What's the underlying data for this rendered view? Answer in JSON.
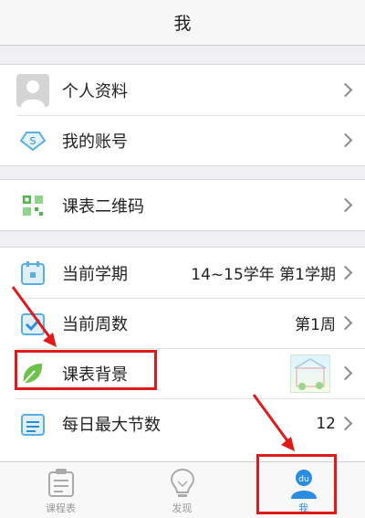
{
  "header": {
    "title": "我"
  },
  "profile_section": {
    "items": [
      {
        "label": "个人资料",
        "icon": "avatar-icon"
      },
      {
        "label": "我的账号",
        "icon": "account-diamond-icon"
      }
    ]
  },
  "qr_section": {
    "items": [
      {
        "label": "课表二维码",
        "icon": "qrcode-icon"
      }
    ]
  },
  "settings_section": {
    "items": [
      {
        "label": "当前学期",
        "value": "14~15学年 第1学期",
        "icon": "calendar-icon"
      },
      {
        "label": "当前周数",
        "value": "第1周",
        "icon": "check-calendar-icon"
      },
      {
        "label": "课表背景",
        "icon": "leaf-icon"
      },
      {
        "label": "每日最大节数",
        "value": "12",
        "icon": "list-icon"
      }
    ]
  },
  "tabbar": {
    "tabs": [
      {
        "label": "课程表",
        "icon": "schedule-icon"
      },
      {
        "label": "发现",
        "icon": "bulb-icon"
      },
      {
        "label": "我",
        "icon": "du-user-icon",
        "active": true
      }
    ]
  },
  "colors": {
    "accent": "#2a8de0",
    "annotation_red": "#e01919",
    "green": "#4cb849"
  }
}
